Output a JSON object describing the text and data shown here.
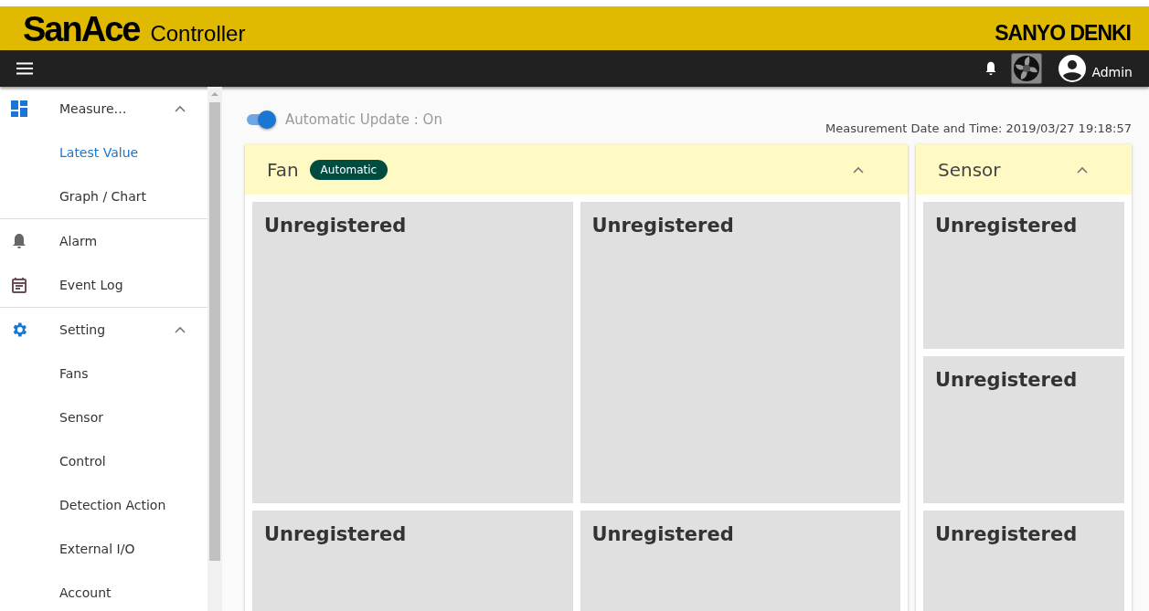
{
  "header": {
    "logo": "SanAce",
    "product": "Controller",
    "brand": "SANYO DENKI"
  },
  "toolbar": {
    "user": "Admin"
  },
  "sidebar": {
    "sections": [
      {
        "items": [
          {
            "label": "Measure…",
            "expanded": true,
            "children": [
              {
                "label": "Latest Value",
                "selected": true
              },
              {
                "label": "Graph / Chart",
                "selected": false
              }
            ]
          }
        ]
      },
      {
        "items": [
          {
            "label": "Alarm"
          },
          {
            "label": "Event Log"
          }
        ]
      },
      {
        "items": [
          {
            "label": "Setting",
            "expanded": true,
            "children": [
              {
                "label": "Fans",
                "selected": false
              },
              {
                "label": "Sensor",
                "selected": false
              },
              {
                "label": "Control",
                "selected": false
              },
              {
                "label": "Detection Action",
                "selected": false
              },
              {
                "label": "External I/O",
                "selected": false
              },
              {
                "label": "Account",
                "selected": false
              }
            ]
          }
        ]
      }
    ]
  },
  "auto_update": {
    "label": "Automatic Update : On",
    "on": true
  },
  "measurement_time": "Measurement Date and Time: 2019/03/27 19:18:57",
  "panels": [
    {
      "kind": "fan",
      "title": "Fan",
      "badge": "Automatic",
      "expanded": true,
      "tiles": [
        "Unregistered",
        "Unregistered",
        "Unregistered",
        "Unregistered"
      ]
    },
    {
      "kind": "sensor",
      "title": "Sensor",
      "expanded": true,
      "tiles": [
        "Unregistered",
        "Unregistered",
        "Unregistered"
      ]
    }
  ]
}
